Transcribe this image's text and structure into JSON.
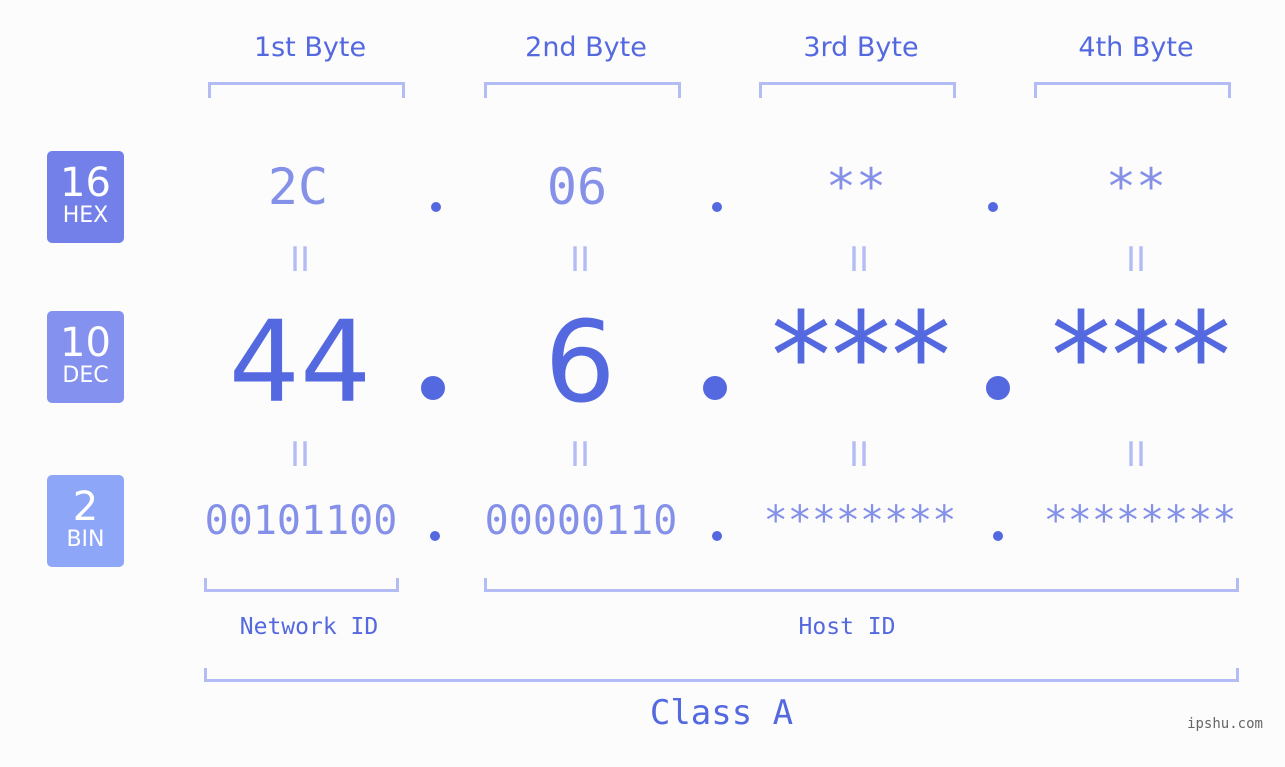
{
  "badges": [
    {
      "num": "16",
      "label": "HEX",
      "color": "#7480ea"
    },
    {
      "num": "10",
      "label": "DEC",
      "color": "#8491ee"
    },
    {
      "num": "2",
      "label": "BIN",
      "color": "#8ea6f7"
    }
  ],
  "bytes": [
    {
      "header": "1st Byte",
      "hex": "2C",
      "dec": "44",
      "bin": "00101100"
    },
    {
      "header": "2nd Byte",
      "hex": "06",
      "dec": "6",
      "bin": "00000110"
    },
    {
      "header": "3rd Byte",
      "hex": "**",
      "dec": "***",
      "bin": "********"
    },
    {
      "header": "4th Byte",
      "hex": "**",
      "dec": "***",
      "bin": "********"
    }
  ],
  "equals": "II",
  "labels": {
    "network": "Network ID",
    "host": "Host ID",
    "class": "Class A"
  },
  "watermark": "ipshu.com",
  "colors": {
    "accent": "#5468e0",
    "light": "#8591e8",
    "bracket": "#b3bcf5",
    "background": "#fbfcfb"
  }
}
